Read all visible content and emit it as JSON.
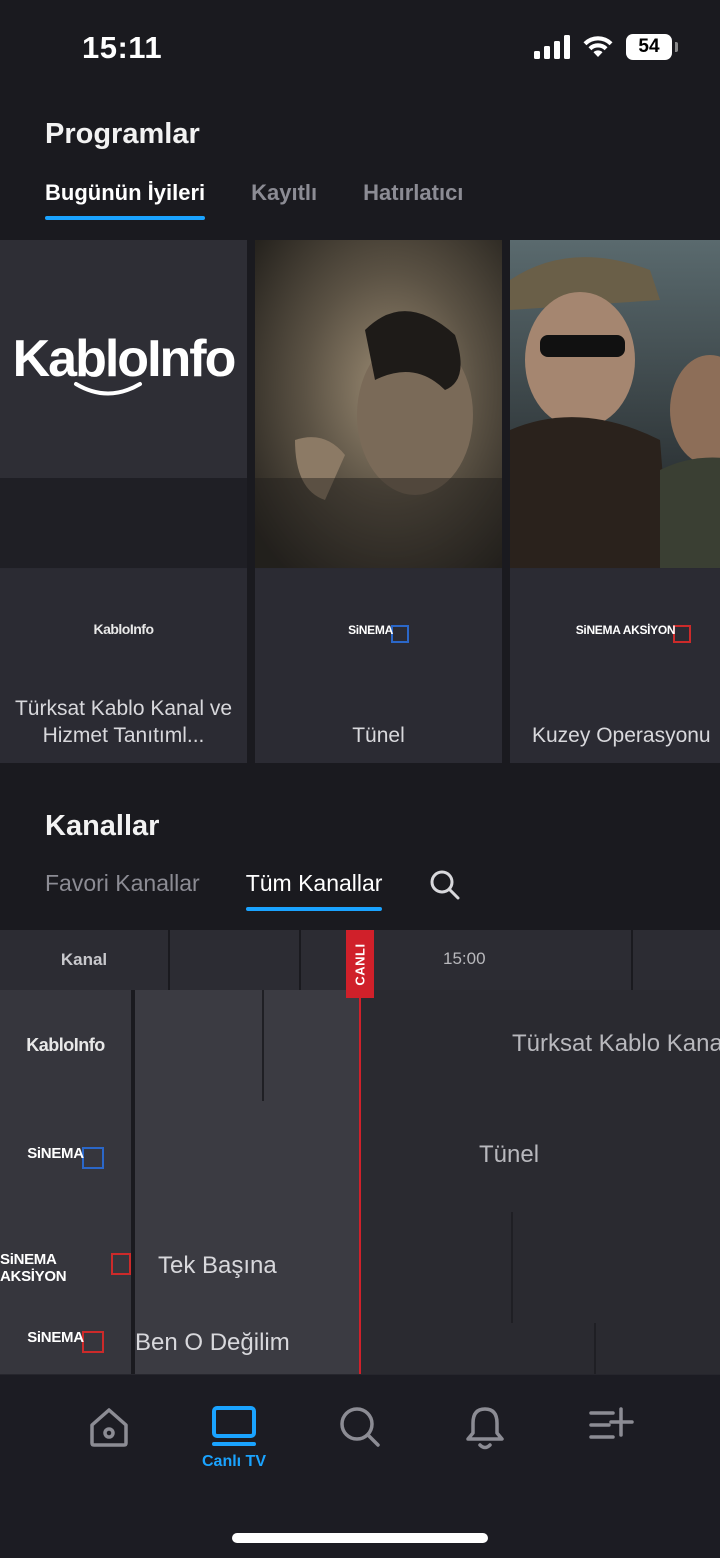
{
  "status_bar": {
    "time": "15:11",
    "battery": "54"
  },
  "programs": {
    "title": "Programlar",
    "tabs": [
      {
        "label": "Bugünün İyileri",
        "active": true
      },
      {
        "label": "Kayıtlı",
        "active": false
      },
      {
        "label": "Hatırlatıcı",
        "active": false
      }
    ],
    "cards": [
      {
        "channel_logo": "KabloInfo",
        "title": "Türksat Kablo Kanal ve Hizmet Tanıtıml..."
      },
      {
        "channel_logo": "SiNEMA",
        "title": "Tünel"
      },
      {
        "channel_logo": "SiNEMA AKSİYON",
        "title": "Kuzey Operasyonu"
      }
    ],
    "hero_logo": "KabloInfo"
  },
  "channels": {
    "title": "Kanallar",
    "tabs": [
      {
        "label": "Favori Kanallar",
        "active": false
      },
      {
        "label": "Tüm Kanallar",
        "active": true
      }
    ],
    "guide": {
      "column_label": "Kanal",
      "time_label": "15:00",
      "live_label": "CANLI",
      "rows": [
        {
          "logo": "KabloInfo",
          "program": "Türksat Kablo Kanal"
        },
        {
          "logo": "SiNEMA",
          "program": "Tünel"
        },
        {
          "logo": "SiNEMA AKSİYON",
          "program": "Tek Başına"
        },
        {
          "logo": "SiNEMA",
          "program": "Ben O Değilim"
        }
      ]
    }
  },
  "bottom_nav": {
    "items": [
      {
        "icon": "home-icon",
        "label": ""
      },
      {
        "icon": "tv-icon",
        "label": "Canlı TV",
        "active": true
      },
      {
        "icon": "search-icon",
        "label": ""
      },
      {
        "icon": "bell-icon",
        "label": ""
      },
      {
        "icon": "menu-plus-icon",
        "label": ""
      }
    ]
  },
  "colors": {
    "accent": "#1aa3ff",
    "live": "#d0202a",
    "background": "#1a1a1f"
  }
}
